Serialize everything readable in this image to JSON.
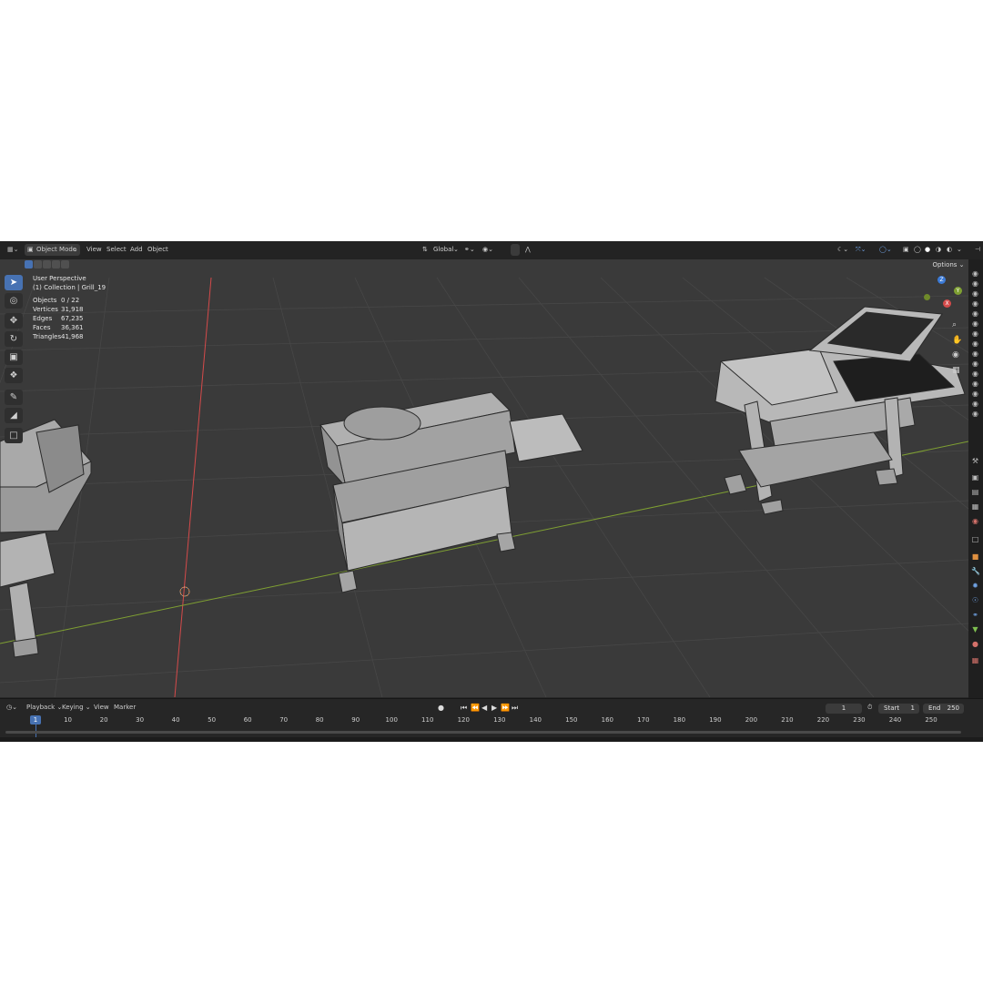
{
  "header": {
    "mode": "Object Mode",
    "menu": [
      "View",
      "Select",
      "Add",
      "Object"
    ],
    "transform_orientation": "Global",
    "options_label": "Options"
  },
  "viewport_info": {
    "view_name": "User Perspective",
    "collection": "(1) Collection | Grill_19",
    "stats": [
      {
        "label": "Objects",
        "value": "0 / 22"
      },
      {
        "label": "Vertices",
        "value": "31,918"
      },
      {
        "label": "Edges",
        "value": "67,235"
      },
      {
        "label": "Faces",
        "value": "36,361"
      },
      {
        "label": "Triangles",
        "value": "41,968"
      }
    ]
  },
  "gizmo": {
    "z": "Z",
    "y": "Y",
    "x": "X"
  },
  "timeline": {
    "menu": [
      "Playback",
      "Keying",
      "View",
      "Marker"
    ],
    "current_frame": "1",
    "start_label": "Start",
    "start_value": "1",
    "end_label": "End",
    "end_value": "250",
    "ruler": [
      "1",
      "10",
      "20",
      "30",
      "40",
      "50",
      "60",
      "70",
      "80",
      "90",
      "100",
      "110",
      "120",
      "130",
      "140",
      "150",
      "160",
      "170",
      "180",
      "190",
      "200",
      "210",
      "220",
      "230",
      "240",
      "250"
    ]
  },
  "colors": {
    "accent": "#4772b3",
    "x_axis": "#d44a4a",
    "y_axis": "#7fa032",
    "grid": "#454545",
    "viewport_bg": "#3a3a3a"
  }
}
